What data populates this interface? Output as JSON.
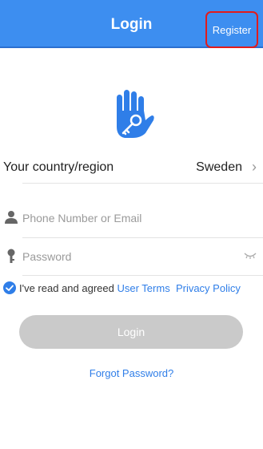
{
  "header": {
    "title": "Login",
    "register_label": "Register"
  },
  "country": {
    "label": "Your country/region",
    "value": "Sweden",
    "chevron": "›"
  },
  "phone_field": {
    "placeholder": "Phone Number or Email",
    "value": "",
    "icon": "person-icon"
  },
  "password_field": {
    "placeholder": "Password",
    "value": "",
    "icon": "key-icon",
    "toggle_icon": "eye-closed-icon"
  },
  "agreement": {
    "checked": true,
    "text": "I've read and agreed",
    "user_terms": "User Terms",
    "privacy_policy": "Privacy Policy"
  },
  "login_button": {
    "label": "Login",
    "enabled": false
  },
  "forgot_password": "Forgot Password?",
  "colors": {
    "header": "#3d8ef0",
    "link": "#2f7ee8",
    "button_disabled": "#cacaca",
    "highlight_border": "#e21b1b"
  }
}
